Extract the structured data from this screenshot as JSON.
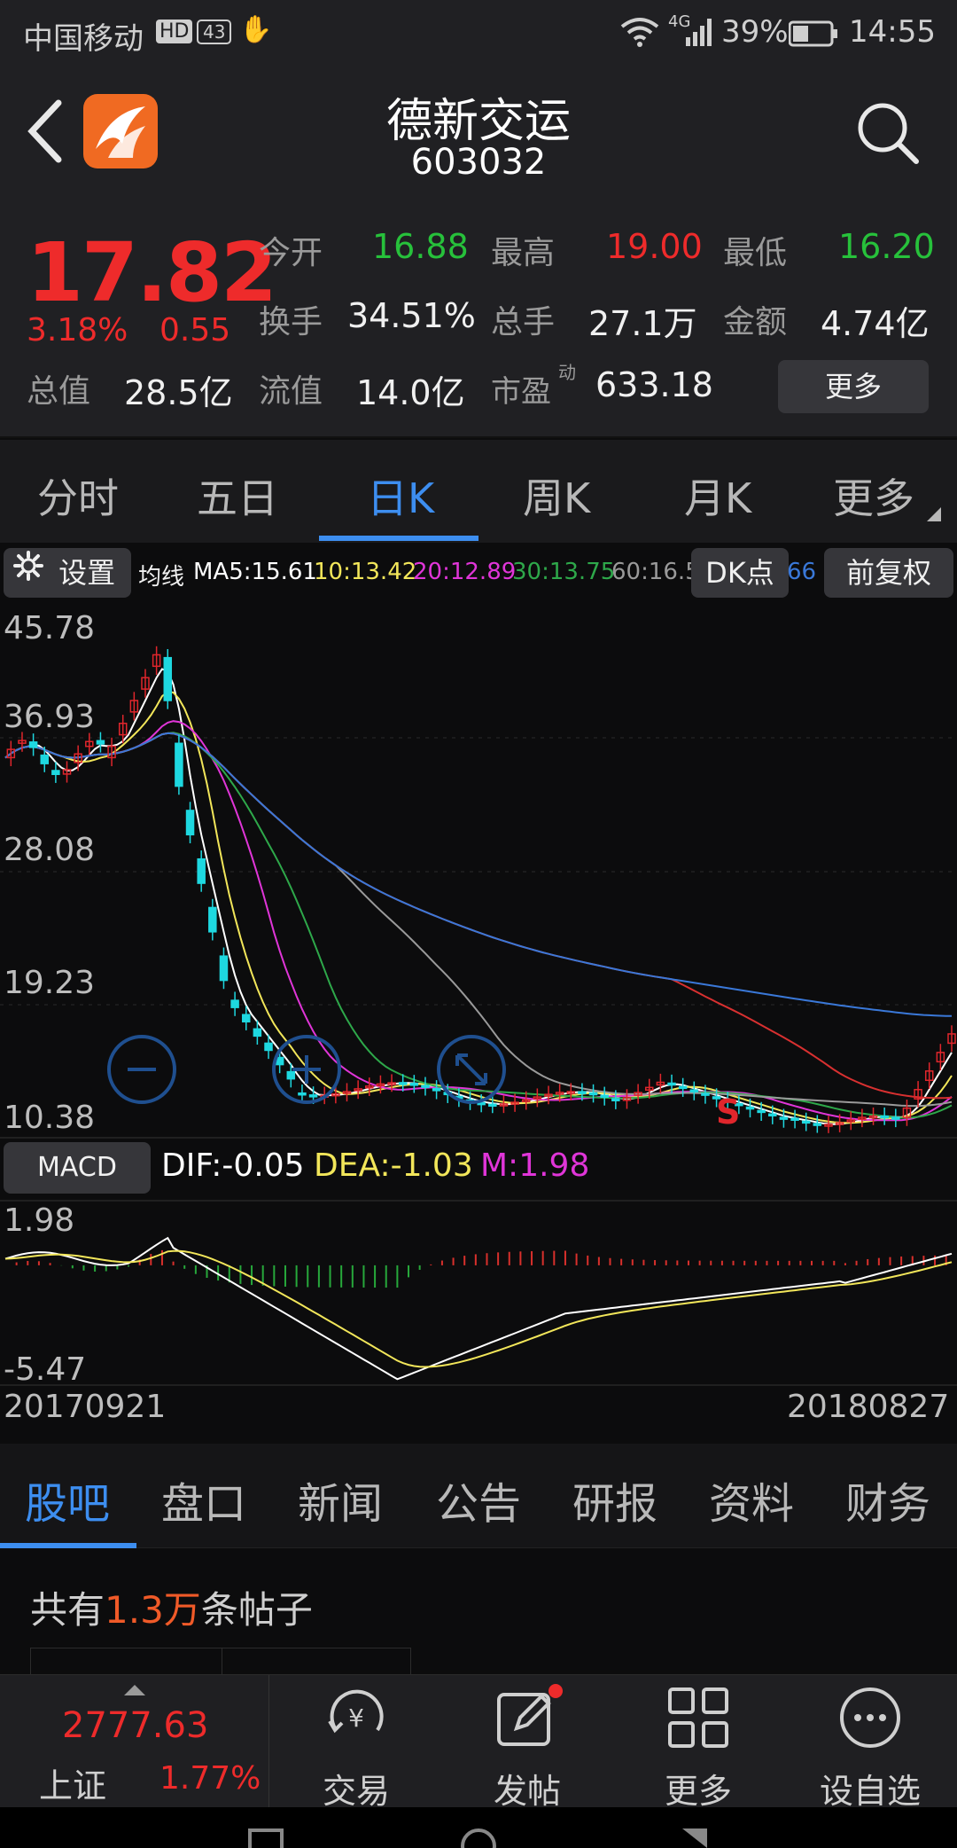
{
  "status_bar": {
    "carrier": "中国移动",
    "hd": "HD",
    "sim_badge": "43",
    "network": "4G",
    "battery_pct": "39%",
    "time": "14:55"
  },
  "header": {
    "stock_name": "德新交运",
    "stock_code": "603032",
    "icons": [
      "back-icon",
      "app-logo",
      "search-icon"
    ]
  },
  "quote": {
    "price": "17.82",
    "change_pct": "3.18%",
    "change_amt": "0.55",
    "market_cap_label": "总值",
    "market_cap": "28.5亿",
    "fields": [
      {
        "label": "今开",
        "value": "16.88"
      },
      {
        "label": "最高",
        "value": "19.00"
      },
      {
        "label": "最低",
        "value": "16.20"
      },
      {
        "label": "换手",
        "value": "34.51%"
      },
      {
        "label": "总手",
        "value": "27.1万"
      },
      {
        "label": "金额",
        "value": "4.74亿"
      },
      {
        "label": "流值",
        "value": "14.0亿"
      },
      {
        "label": "市盈",
        "value": "633.18"
      }
    ],
    "pe_sup": "动",
    "more_button": "更多",
    "colors": {
      "up": "#ee2b2b",
      "down": "#27c13b"
    }
  },
  "period_tabs": {
    "items": [
      "分时",
      "五日",
      "日K",
      "周K",
      "月K",
      "更多"
    ],
    "active": "日K"
  },
  "ma_row": {
    "settings": "设置",
    "ma_prefix": "均线",
    "ma5": "MA5:15.61",
    "ma10": "10:13.42",
    "ma20": "20:12.89",
    "ma30": "30:13.75",
    "ma60": "60:16.5",
    "ma_tail": "66",
    "dk_button": "DK点",
    "adjust_button": "前复权"
  },
  "chart_data": {
    "type": "candlestick",
    "price_axis_labels": [
      "45.78",
      "36.93",
      "28.08",
      "19.23",
      "10.38"
    ],
    "price_range": [
      10.38,
      45.78
    ],
    "start_date": "20170921",
    "end_date": "20180827",
    "sell_marker": "S",
    "ma_colors": {
      "ma5": "#ffffff",
      "ma10": "#f2e65a",
      "ma20": "#e035d8",
      "ma30": "#2ea84a",
      "ma60": "#9a9a9a",
      "ma120": "#d83030",
      "ma250": "#3a78d8"
    },
    "indicator_label": "MACD",
    "dif": "DIF:-0.05",
    "dea": "DEA:-1.03",
    "m": "M:1.98",
    "macd_axis_labels": [
      "1.98",
      "-5.47"
    ],
    "macd_range": [
      -5.47,
      1.98
    ]
  },
  "bottom_tabs": {
    "items": [
      "股吧",
      "盘口",
      "新闻",
      "公告",
      "研报",
      "资料",
      "财务"
    ],
    "active": "股吧"
  },
  "posts": {
    "prefix": "共有",
    "count": "1.3万",
    "suffix": "条帖子"
  },
  "bottom_bar": {
    "index_value": "2777.63",
    "index_name": "上证",
    "index_pct": "1.77%",
    "items": [
      {
        "label": "交易",
        "icon": "trade-icon"
      },
      {
        "label": "发帖",
        "icon": "post-icon"
      },
      {
        "label": "更多",
        "icon": "grid-icon"
      },
      {
        "label": "设自选",
        "icon": "more-icon"
      }
    ]
  }
}
